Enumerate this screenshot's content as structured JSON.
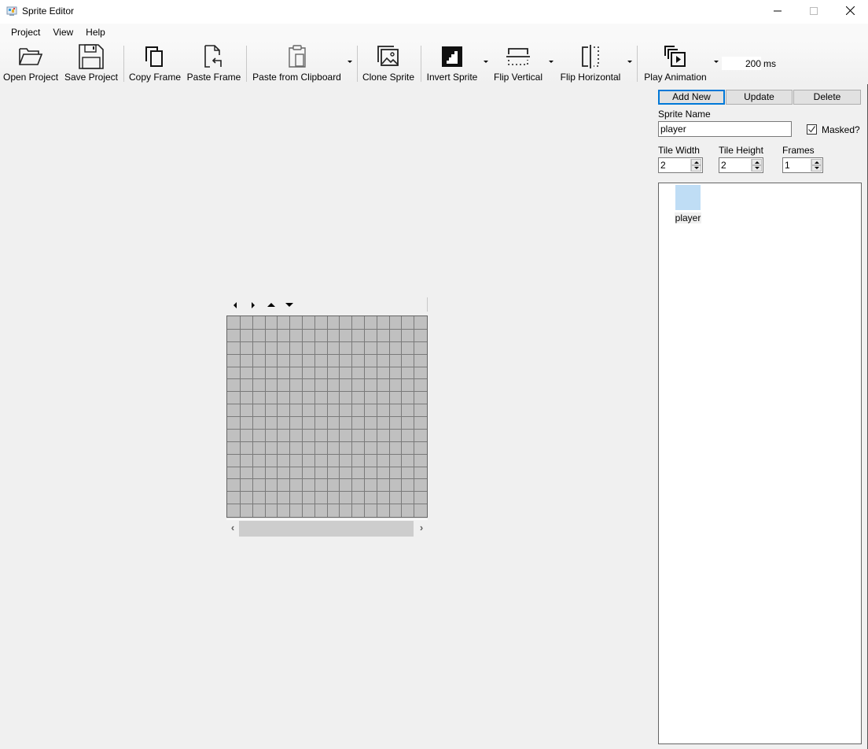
{
  "window": {
    "title": "Sprite Editor",
    "app_icon": "sprite-editor-app-icon",
    "controls": [
      "minimize-icon",
      "maximize-icon",
      "close-icon"
    ]
  },
  "menu": {
    "items": [
      {
        "label": "Project"
      },
      {
        "label": "View"
      },
      {
        "label": "Help"
      }
    ]
  },
  "toolbar": {
    "buttons": [
      {
        "label": "Open Project",
        "icon": "folder-open-icon"
      },
      {
        "label": "Save Project",
        "icon": "floppy-disk-icon"
      },
      {
        "label": "Copy Frame",
        "icon": "copy-icon"
      },
      {
        "label": "Paste Frame",
        "icon": "paste-icon"
      },
      {
        "label": "Paste from Clipboard",
        "icon": "clipboard-icon",
        "has_dropdown": true
      },
      {
        "label": "Clone Sprite",
        "icon": "clone-image-icon"
      },
      {
        "label": "Invert Sprite",
        "icon": "invert-icon",
        "has_dropdown": true
      },
      {
        "label": "Flip Vertical",
        "icon": "flip-vertical-icon",
        "has_dropdown": true
      },
      {
        "label": "Flip Horizontal",
        "icon": "flip-horizontal-icon",
        "has_dropdown": true
      },
      {
        "label": "Play Animation",
        "icon": "play-animation-icon",
        "has_dropdown": true
      }
    ],
    "interval_value": "200",
    "interval_unit": "ms"
  },
  "sprite_panel": {
    "add_new_label": "Add New",
    "update_label": "Update",
    "delete_label": "Delete",
    "sprite_name_label": "Sprite Name",
    "sprite_name_value": "player",
    "masked_label": "Masked?",
    "masked_checked": true,
    "tile_width_label": "Tile Width",
    "tile_width_value": "2",
    "tile_height_label": "Tile Height",
    "tile_height_value": "2",
    "frames_label": "Frames",
    "frames_value": "1",
    "sprites": [
      {
        "name": "player",
        "thumb_color": "#bfddf5"
      }
    ]
  },
  "editor": {
    "nav_arrows": [
      "shift-left-icon",
      "shift-right-icon",
      "shift-up-icon",
      "shift-down-icon"
    ],
    "grid_columns": 16,
    "grid_rows": 16,
    "pixel_color": "#c0c0c0",
    "grid_line_color": "#7a7a7a",
    "scroll_left": "‹",
    "scroll_right": "›"
  }
}
